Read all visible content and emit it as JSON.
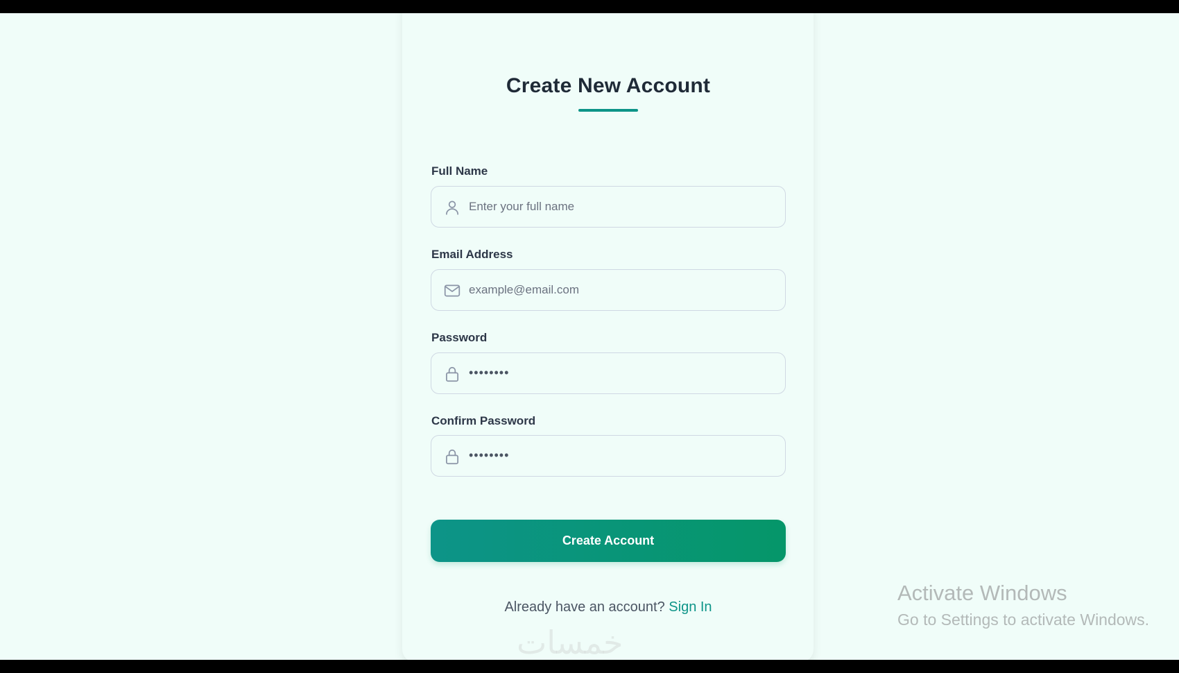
{
  "page": {
    "title": "Create New Account"
  },
  "form": {
    "fields": [
      {
        "label": "Full Name",
        "placeholder": "Enter your full name",
        "value": "",
        "icon": "user-icon"
      },
      {
        "label": "Email Address",
        "placeholder": "example@email.com",
        "value": "",
        "icon": "mail-icon"
      },
      {
        "label": "Password",
        "placeholder": "",
        "value": "••••••••",
        "icon": "lock-icon"
      },
      {
        "label": "Confirm Password",
        "placeholder": "",
        "value": "••••••••",
        "icon": "lock-icon"
      }
    ],
    "submit_label": "Create Account"
  },
  "footer": {
    "prompt": "Already have an account?",
    "link_label": "Sign In"
  },
  "overlay": {
    "activate_title": "Activate Windows",
    "activate_sub": "Go to Settings to activate Windows.",
    "logo_text": "خمسات"
  },
  "colors": {
    "accent": "#0d9488",
    "background": "#f0fdf9",
    "text": "#1f2a37"
  }
}
